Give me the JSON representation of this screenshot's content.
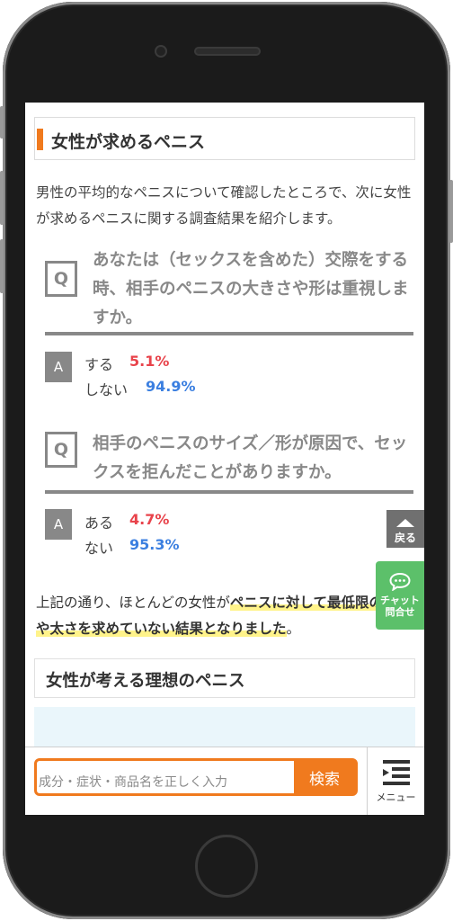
{
  "article": {
    "heading": "女性が求めるペニス",
    "intro": "男性の平均的なペニスについて確認したところで、次に女性が求めるペニスに関する調査結果を紹介します。",
    "qa": [
      {
        "q_label": "Q",
        "question": "あなたは（セックスを含めた）交際をする時、相手のペニスの大きさや形は重視しますか。",
        "a_label": "A",
        "answers": [
          {
            "label": "する",
            "value": "5.1%",
            "color": "#e8434b"
          },
          {
            "label": "しない",
            "value": "94.9%",
            "color": "#3b7fe0"
          }
        ]
      },
      {
        "q_label": "Q",
        "question": "相手のペニスのサイズ／形が原因で、セックスを拒んだことがありますか。",
        "a_label": "A",
        "answers": [
          {
            "label": "ある",
            "value": "4.7%",
            "color": "#e8434b"
          },
          {
            "label": "ない",
            "value": "95.3%",
            "color": "#3b7fe0"
          }
        ]
      }
    ],
    "summary_pre": "上記の通り、ほとんどの女性が",
    "summary_highlight": "ペニスに対して最低限の長さや太さを求めていない結果となりました",
    "summary_post": "。",
    "heading2": "女性が考える理想のペニス"
  },
  "floating": {
    "back_label": "戻る",
    "chat_label_1": "チャット",
    "chat_label_2": "問合せ"
  },
  "bottom_bar": {
    "search_placeholder": "成分・症状・商品名を正しく入力",
    "search_button": "検索",
    "menu_label": "メニュー"
  },
  "colors": {
    "accent": "#f07a1e",
    "chat": "#5cc06a",
    "red": "#e8434b",
    "blue": "#3b7fe0"
  }
}
